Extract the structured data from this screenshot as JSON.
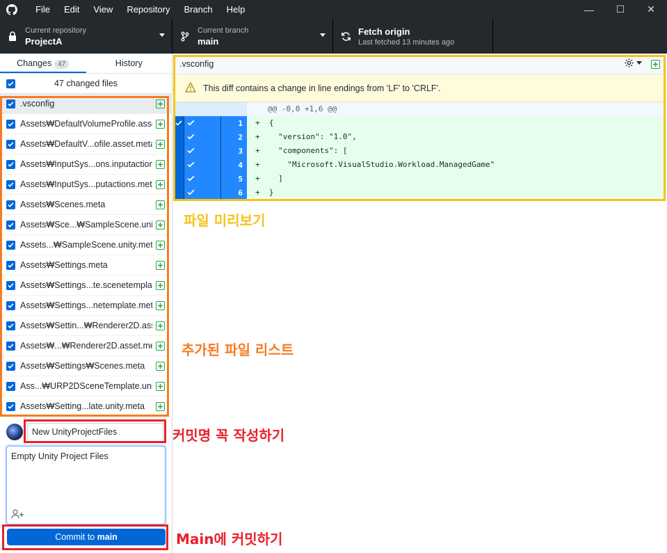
{
  "menu": [
    "File",
    "Edit",
    "View",
    "Repository",
    "Branch",
    "Help"
  ],
  "window_controls": {
    "minimize": "—",
    "maximize": "☐",
    "close": "✕"
  },
  "toolbar": {
    "repo_label": "Current repository",
    "repo_name": "ProjectA",
    "branch_label": "Current branch",
    "branch_name": "main",
    "fetch_title": "Fetch origin",
    "fetch_sub": "Last fetched 13 minutes ago"
  },
  "tabs": {
    "changes": "Changes",
    "changes_count": "47",
    "history": "History"
  },
  "changes_summary": "47 changed files",
  "files": [
    ".vsconfig",
    "Assets₩DefaultVolumeProfile.asset",
    "Assets₩DefaultV...ofile.asset.meta",
    "Assets₩InputSys...ons.inputactions",
    "Assets₩InputSys...putactions.meta",
    "Assets₩Scenes.meta",
    "Assets₩Sce...₩SampleScene.unity",
    "Assets...₩SampleScene.unity.meta",
    "Assets₩Settings.meta",
    "Assets₩Settings...te.scenetemplate",
    "Assets₩Settings...netemplate.meta",
    "Assets₩Settin...₩Renderer2D.asset",
    "Assets₩...₩Renderer2D.asset.meta",
    "Assets₩Settings₩Scenes.meta",
    "Ass...₩URP2DSceneTemplate.unity",
    "Assets₩Setting...late.unity.meta"
  ],
  "commit": {
    "summary": "New UnityProjectFiles",
    "description": "Empty Unity Project Files",
    "button_prefix": "Commit to ",
    "button_branch": "main"
  },
  "diff": {
    "path": ".vsconfig",
    "warning": "This diff contains a change in line endings from 'LF' to 'CRLF'.",
    "hunk": "@@ -0,0 +1,6 @@",
    "lines": [
      {
        "num": "1",
        "text": "+  {"
      },
      {
        "num": "2",
        "text": "+    \"version\": \"1.0\","
      },
      {
        "num": "3",
        "text": "+    \"components\": ["
      },
      {
        "num": "4",
        "text": "+      \"Microsoft.VisualStudio.Workload.ManagedGame\""
      },
      {
        "num": "5",
        "text": "+    ]"
      },
      {
        "num": "6",
        "text": "+  }"
      }
    ]
  },
  "annotations": {
    "preview": "파일 미리보기",
    "added_list": "추가된 파일 리스트",
    "commit_name": "커밋명 꼭 작성하기",
    "commit_main": "Main에 커밋하기"
  },
  "colors": {
    "yellow": "#f7c21b",
    "orange": "#f57c22",
    "red": "#e8202a",
    "blue": "#0366d6",
    "green": "#28a745"
  }
}
